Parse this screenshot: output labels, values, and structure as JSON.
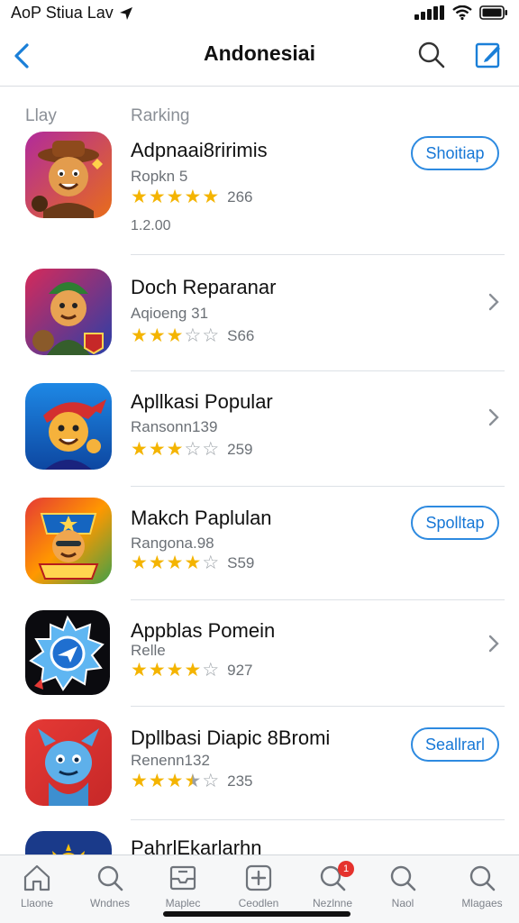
{
  "status_bar": {
    "carrier": "AoP Stiua Lav"
  },
  "nav": {
    "title": "Andonesiai"
  },
  "columns": {
    "left": "Llay",
    "right": "Rarking"
  },
  "apps": [
    {
      "name": "Adpnaai8ririmis",
      "subtitle": "Ropkn 5",
      "rating": 5,
      "rating_count": "266",
      "extra": "1.2.00",
      "action": "Shoitiap"
    },
    {
      "name": "Doch Reparanar",
      "subtitle": "Aqioeng 31",
      "rating": 3,
      "rating_count": "S66",
      "extra": "",
      "action": ""
    },
    {
      "name": "Apllkasi Popular",
      "subtitle": "Ransonn139",
      "rating": 3,
      "rating_count": "259",
      "extra": "",
      "action": ""
    },
    {
      "name": "Makch Paplulan",
      "subtitle": "Rangona.98",
      "rating": 4,
      "rating_count": "S59",
      "extra": "",
      "action": "Spolltap"
    },
    {
      "name": "Appblas Pomein",
      "subtitle": "Relle",
      "rating": 4,
      "rating_count": "927",
      "extra": "",
      "action": ""
    },
    {
      "name": "Dpllbasi Diapic 8Bromi",
      "subtitle": "Renenn132",
      "rating": 3.5,
      "rating_count": "235",
      "extra": "",
      "action": "Seallrarl"
    },
    {
      "name": "PahrlEkarlarhn",
      "subtitle": "",
      "rating": 0,
      "rating_count": "",
      "extra": "",
      "action": ""
    }
  ],
  "tabs": [
    {
      "label": "Llaone",
      "icon": "home-icon"
    },
    {
      "label": "Wndnes",
      "icon": "search-icon"
    },
    {
      "label": "Maplec",
      "icon": "inbox-icon"
    },
    {
      "label": "Ceodlen",
      "icon": "add-square-icon"
    },
    {
      "label": "Nezlnne",
      "icon": "search-icon",
      "badge": "1"
    },
    {
      "label": "Naol",
      "icon": "search-icon"
    },
    {
      "label": "Mlagaes",
      "icon": "search-icon"
    }
  ],
  "colors": {
    "accent": "#2d8ae0",
    "star": "#f4b400",
    "badge": "#e5322d"
  }
}
